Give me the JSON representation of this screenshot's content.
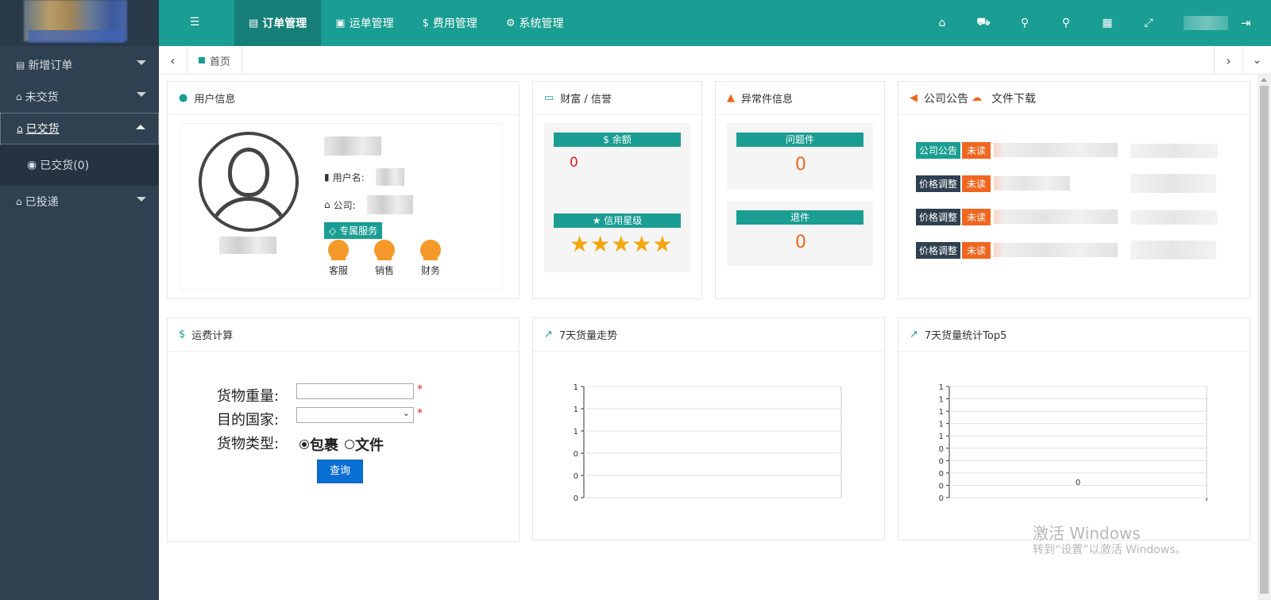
{
  "topnav": [
    {
      "label": "订单管理",
      "icon": "document-icon",
      "active": true
    },
    {
      "label": "运单管理",
      "icon": "address-book-icon",
      "active": false
    },
    {
      "label": "费用管理",
      "icon": "dollar-icon",
      "active": false
    },
    {
      "label": "系统管理",
      "icon": "gear-icon",
      "active": false
    }
  ],
  "sidebar": {
    "items": [
      {
        "label": "新增订单"
      },
      {
        "label": "未交货"
      },
      {
        "label": "已交货"
      },
      {
        "label": "已投递"
      }
    ],
    "sub": {
      "label": "已交货(0)"
    }
  },
  "tabs": {
    "home": "首页"
  },
  "user_panel": {
    "title": "用户信息",
    "username_label": "用户名:",
    "company_label": "公司:",
    "service_badge": "专属服务",
    "services": [
      "客服",
      "销售",
      "财务"
    ]
  },
  "wealth_panel": {
    "title": "财富 / 信誉",
    "balance_label": "$ 余额",
    "balance_value": "0",
    "credit_label": "信用星级",
    "stars": 5,
    "stars_text": "★★★★★"
  },
  "exception_panel": {
    "title": "异常件信息",
    "problem_label": "问题件",
    "problem_value": "0",
    "return_label": "退件",
    "return_value": "0"
  },
  "notice_panel": {
    "title_notice": "公司公告",
    "title_download": "文件下载",
    "rows": [
      {
        "type": "公司公告",
        "status": "未读"
      },
      {
        "type": "价格调整",
        "status": "未读"
      },
      {
        "type": "价格调整",
        "status": "未读"
      },
      {
        "type": "价格调整",
        "status": "未读"
      }
    ]
  },
  "freight_panel": {
    "title": "运费计算",
    "weight_label": "货物重量:",
    "country_label": "目的国家:",
    "type_label": "货物类型:",
    "type_options": [
      "包裹",
      "文件"
    ],
    "selected_type": "包裹",
    "required_mark": "*",
    "query_button": "查询"
  },
  "trend_panel": {
    "title": "7天货量走势"
  },
  "top5_panel": {
    "title": "7天货量统计Top5"
  },
  "chart_data": [
    {
      "type": "line",
      "title": "",
      "y_tick_labels": [
        "1",
        "1",
        "1",
        "0",
        "0",
        "0"
      ],
      "series": []
    },
    {
      "type": "bar",
      "title": "",
      "y_tick_labels": [
        "1",
        "1",
        "1",
        "1",
        "1",
        "0",
        "0",
        "0",
        "0",
        "0"
      ],
      "data_labels": [
        "0"
      ],
      "series": []
    }
  ],
  "watermark": {
    "line1": "激活 Windows",
    "line2": "转到“设置”以激活 Windows。"
  },
  "colors": {
    "teal": "#1a9d92",
    "sidebar": "#2f4050",
    "orange": "#f0661f",
    "star": "#f2a70e",
    "query_button": "#0a6fd3"
  }
}
